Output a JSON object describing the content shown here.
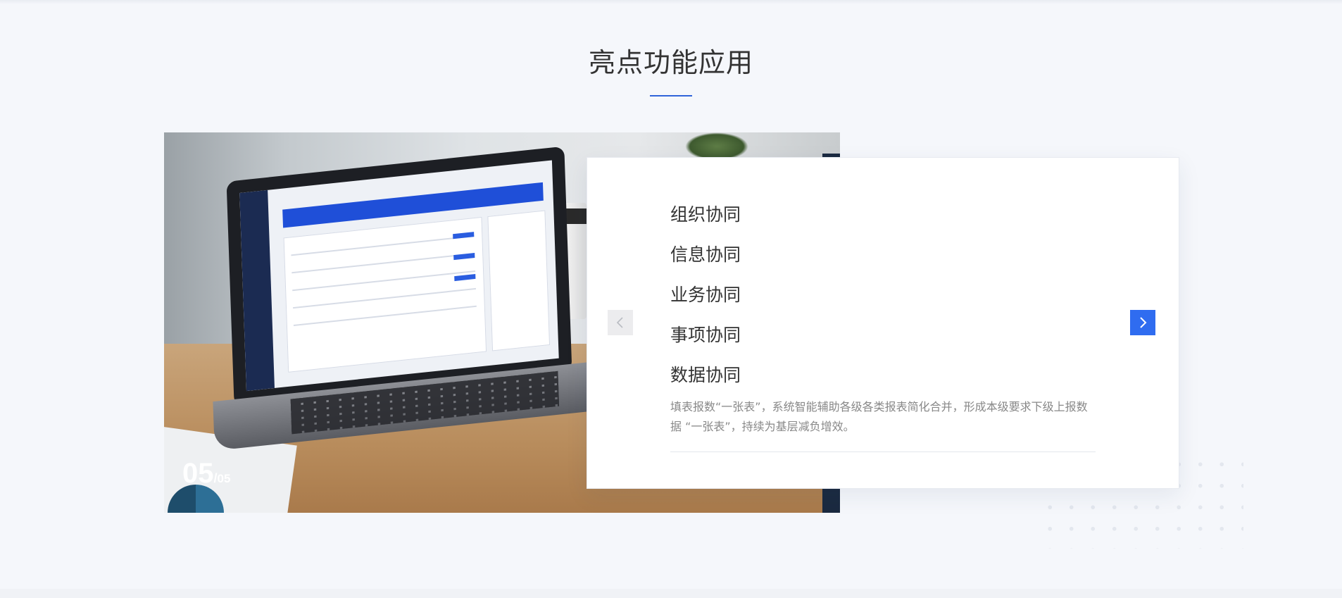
{
  "section": {
    "title": "亮点功能应用"
  },
  "slider": {
    "current": "05",
    "separator": "/",
    "total": "05"
  },
  "features": [
    {
      "label": "组织协同"
    },
    {
      "label": "信息协同"
    },
    {
      "label": "业务协同"
    },
    {
      "label": "事项协同"
    },
    {
      "label": "数据协同"
    }
  ],
  "active_feature": {
    "description": "填表报数“一张表”，系统智能辅助各级各类报表简化合并，形成本级要求下级上报数据 “一张表”，持续为基层减负增效。"
  },
  "nav": {
    "prev_icon": "chevron-left-icon",
    "next_icon": "chevron-right-icon"
  },
  "colors": {
    "accent": "#2f6cf0",
    "title_underline": "#2f64d9",
    "background": "#f5f7fb"
  }
}
